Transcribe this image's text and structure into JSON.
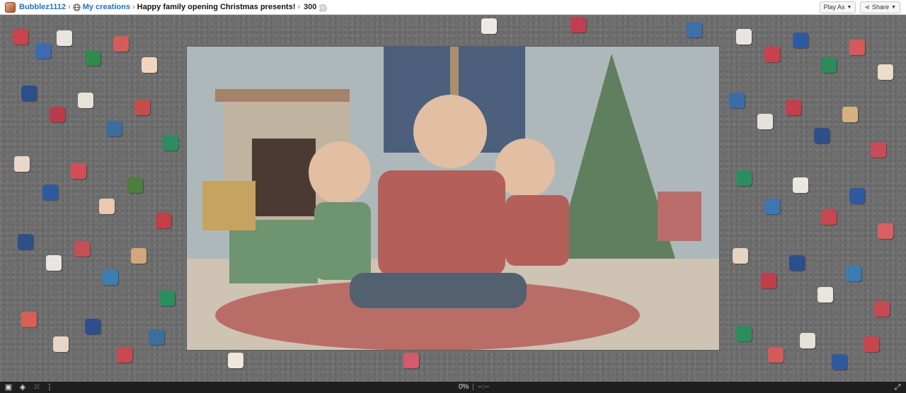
{
  "header": {
    "username": "Bubblez1112",
    "collection": "My creations",
    "puzzle_title": "Happy family opening Christmas presents!",
    "piece_count": "300",
    "play_as_label": "Play As",
    "share_label": "Share"
  },
  "footer": {
    "progress": "0%",
    "divider": "|",
    "timer": "--:--"
  },
  "colors": {
    "board": "#6f6f6f",
    "link": "#1b74c8"
  },
  "icons": [
    "avatar",
    "globe-icon",
    "chevron-right-icon",
    "puzzle-piece-icon",
    "caret-down-icon",
    "share-icon",
    "fullscreen-icon",
    "ghost-icon",
    "grid-icon",
    "more-icon",
    "expand-icon"
  ]
}
